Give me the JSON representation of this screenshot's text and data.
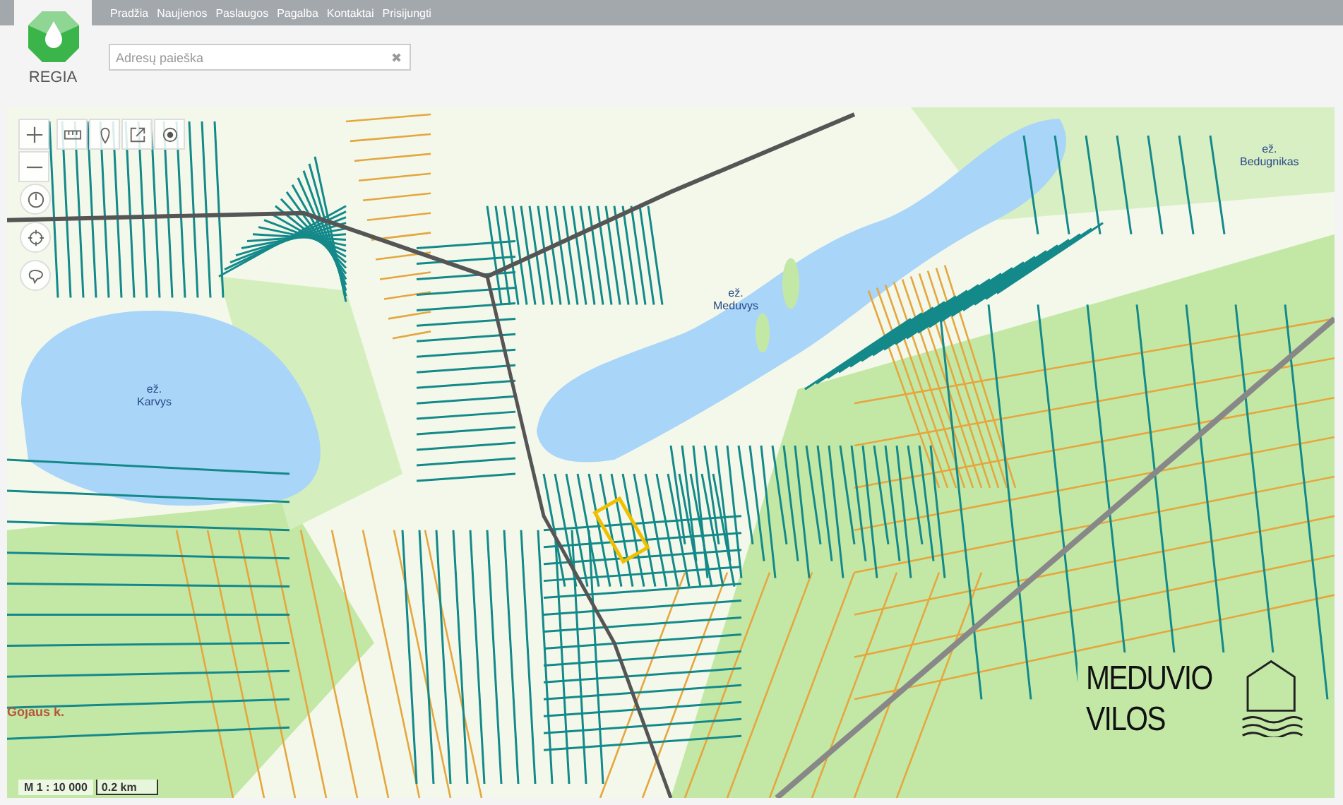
{
  "header": {
    "logo_text": "REGIA",
    "nav": [
      "Pradžia",
      "Naujienos",
      "Paslaugos",
      "Pagalba",
      "Kontaktai",
      "Prisijungti"
    ],
    "search": {
      "placeholder": "Adresų paieška",
      "clear": "✖"
    }
  },
  "map": {
    "labels": [
      {
        "kind": "lake",
        "prefix": "ež.",
        "name": "Karvys"
      },
      {
        "kind": "lake",
        "prefix": "ež.",
        "name": "Meduvys"
      },
      {
        "kind": "lake",
        "prefix": "ež.",
        "name": "Bedugnikas"
      },
      {
        "kind": "village",
        "name": "Gojaus k."
      }
    ],
    "scale": {
      "ratio": "M 1 : 10 000",
      "distance": "0.2 km"
    },
    "brand": {
      "lines": [
        "MEDUVIO",
        "VILOS"
      ]
    }
  }
}
